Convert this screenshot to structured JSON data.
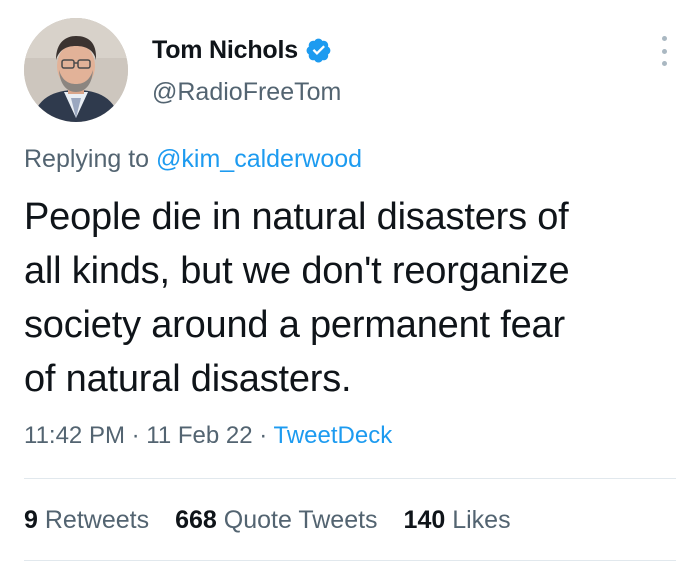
{
  "author": {
    "display_name": "Tom Nichols",
    "handle": "@RadioFreeTom",
    "verified": true
  },
  "reply": {
    "prefix": "Replying to ",
    "mention": "@kim_calderwood"
  },
  "tweet": {
    "text_lines": [
      "People die in natural disasters of",
      "all kinds, but we don't reorganize",
      "society around a permanent fear",
      "of natural disasters."
    ]
  },
  "meta": {
    "time": "11:42 PM",
    "separator": " · ",
    "date": "11 Feb 22",
    "source": "TweetDeck"
  },
  "stats": {
    "retweets_count": "9",
    "retweets_label": "Retweets",
    "quotes_count": "668",
    "quotes_label": "Quote Tweets",
    "likes_count": "140",
    "likes_label": "Likes"
  },
  "colors": {
    "link": "#1d9bf0",
    "secondary_text": "#536471",
    "primary_text": "#0f1419",
    "verified_badge": "#1d9bf0"
  },
  "icons": {
    "verified": "verified-badge-icon",
    "more": "more-options-icon"
  }
}
